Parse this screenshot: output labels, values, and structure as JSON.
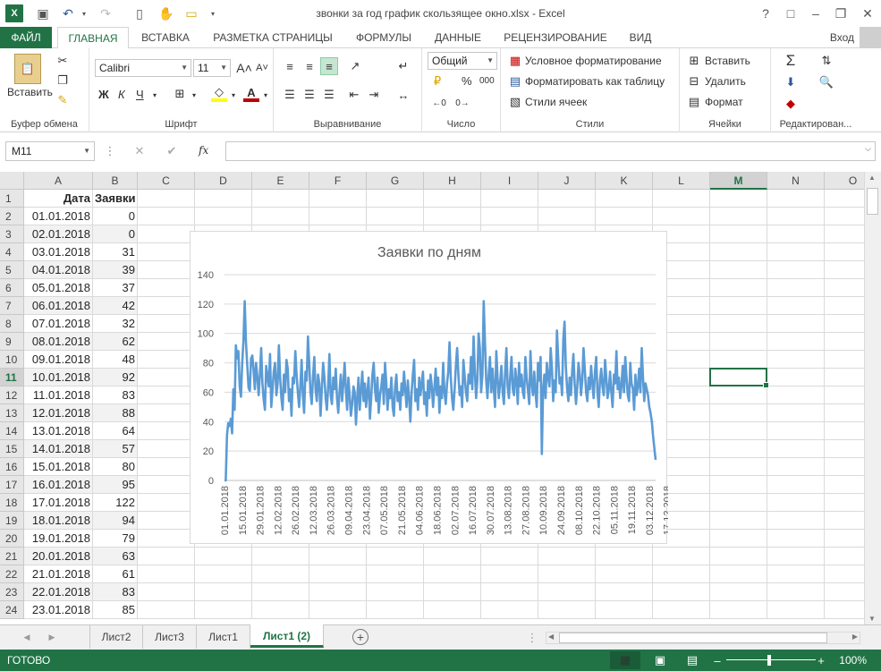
{
  "window": {
    "title": "звонки за год график скользящее окно.xlsx - Excel",
    "help": "?",
    "login": "Вход"
  },
  "tabs": [
    {
      "label": "ФАЙЛ"
    },
    {
      "label": "ГЛАВНАЯ"
    },
    {
      "label": "ВСТАВКА"
    },
    {
      "label": "РАЗМЕТКА СТРАНИЦЫ"
    },
    {
      "label": "ФОРМУЛЫ"
    },
    {
      "label": "ДАННЫЕ"
    },
    {
      "label": "РЕЦЕНЗИРОВАНИЕ"
    },
    {
      "label": "ВИД"
    }
  ],
  "ribbon": {
    "clipboard": {
      "paste": "Вставить",
      "label": "Буфер обмена"
    },
    "font": {
      "name": "Calibri",
      "size": "11",
      "bold": "Ж",
      "italic": "К",
      "underline": "Ч",
      "label": "Шрифт"
    },
    "alignment": {
      "label": "Выравнивание"
    },
    "number": {
      "format": "Общий",
      "percent": "%",
      "thousands": "000",
      "label": "Число"
    },
    "styles": {
      "conditional": "Условное форматирование",
      "as_table": "Форматировать как таблицу",
      "cell_styles": "Стили ячеек",
      "label": "Стили"
    },
    "cells": {
      "insert": "Вставить",
      "delete": "Удалить",
      "format": "Формат",
      "label": "Ячейки"
    },
    "editing": {
      "label": "Редактирован..."
    }
  },
  "formula_bar": {
    "name_box": "M11",
    "fx": "fx",
    "value": ""
  },
  "columns": [
    "A",
    "B",
    "C",
    "D",
    "E",
    "F",
    "G",
    "H",
    "I",
    "J",
    "K",
    "L",
    "M",
    "N",
    "O"
  ],
  "selected_column": "M",
  "selected_row": "11",
  "header_row": {
    "a": "Дата",
    "b": "Заявки"
  },
  "rows": [
    {
      "n": "1"
    },
    {
      "n": "2",
      "a": "01.01.2018",
      "b": "0"
    },
    {
      "n": "3",
      "a": "02.01.2018",
      "b": "0"
    },
    {
      "n": "4",
      "a": "03.01.2018",
      "b": "31"
    },
    {
      "n": "5",
      "a": "04.01.2018",
      "b": "39"
    },
    {
      "n": "6",
      "a": "05.01.2018",
      "b": "37"
    },
    {
      "n": "7",
      "a": "06.01.2018",
      "b": "42"
    },
    {
      "n": "8",
      "a": "07.01.2018",
      "b": "32"
    },
    {
      "n": "9",
      "a": "08.01.2018",
      "b": "62"
    },
    {
      "n": "10",
      "a": "09.01.2018",
      "b": "48"
    },
    {
      "n": "11",
      "a": "10.01.2018",
      "b": "92"
    },
    {
      "n": "12",
      "a": "11.01.2018",
      "b": "83"
    },
    {
      "n": "13",
      "a": "12.01.2018",
      "b": "88"
    },
    {
      "n": "14",
      "a": "13.01.2018",
      "b": "64"
    },
    {
      "n": "15",
      "a": "14.01.2018",
      "b": "57"
    },
    {
      "n": "16",
      "a": "15.01.2018",
      "b": "80"
    },
    {
      "n": "17",
      "a": "16.01.2018",
      "b": "95"
    },
    {
      "n": "18",
      "a": "17.01.2018",
      "b": "122"
    },
    {
      "n": "19",
      "a": "18.01.2018",
      "b": "94"
    },
    {
      "n": "20",
      "a": "19.01.2018",
      "b": "79"
    },
    {
      "n": "21",
      "a": "20.01.2018",
      "b": "63"
    },
    {
      "n": "22",
      "a": "21.01.2018",
      "b": "61"
    },
    {
      "n": "23",
      "a": "22.01.2018",
      "b": "83"
    },
    {
      "n": "24",
      "a": "23.01.2018",
      "b": "85"
    }
  ],
  "sheets": [
    "Лист2",
    "Лист3",
    "Лист1",
    "Лист1 (2)"
  ],
  "active_sheet": "Лист1 (2)",
  "status": {
    "ready": "ГОТОВО",
    "zoom": "100%"
  },
  "colors": {
    "accent": "#217346",
    "series": "#5b9bd5"
  },
  "chart_data": {
    "type": "line",
    "title": "Заявки по дням",
    "xlabel": "",
    "ylabel": "",
    "ylim": [
      0,
      140
    ],
    "yticks": [
      0,
      20,
      40,
      60,
      80,
      100,
      120,
      140
    ],
    "x_start": "01.01.2018",
    "x_end": "31.12.2018",
    "xtick_labels": [
      "01.01.2018",
      "15.01.2018",
      "29.01.2018",
      "12.02.2018",
      "26.02.2018",
      "12.03.2018",
      "26.03.2018",
      "09.04.2018",
      "23.04.2018",
      "07.05.2018",
      "21.05.2018",
      "04.06.2018",
      "18.06.2018",
      "02.07.2018",
      "16.07.2018",
      "30.07.2018",
      "13.08.2018",
      "27.08.2018",
      "10.09.2018",
      "24.09.2018",
      "08.10.2018",
      "22.10.2018",
      "05.11.2018",
      "19.11.2018",
      "03.12.2018",
      "17.12.2018"
    ],
    "grid": true,
    "series": [
      {
        "values": [
          0,
          0,
          31,
          39,
          37,
          42,
          32,
          62,
          48,
          92,
          83,
          88,
          64,
          57,
          80,
          95,
          122,
          94,
          79,
          63,
          61,
          83,
          85,
          75,
          62,
          80,
          70,
          58,
          72,
          90,
          66,
          55,
          48,
          78,
          70,
          64,
          86,
          50,
          62,
          74,
          80,
          58,
          66,
          92,
          70,
          56,
          48,
          72,
          60,
          82,
          76,
          54,
          62,
          44,
          70,
          66,
          88,
          72,
          60,
          50,
          64,
          82,
          58,
          46,
          74,
          68,
          98,
          80,
          60,
          52,
          70,
          84,
          62,
          54,
          72,
          66,
          44,
          62,
          80,
          70,
          56,
          48,
          64,
          86,
          58,
          52,
          70,
          62,
          76,
          56,
          46,
          60,
          72,
          54,
          66,
          80,
          62,
          48,
          70,
          58,
          44,
          52,
          64,
          60,
          38,
          56,
          70,
          48,
          62,
          74,
          54,
          66,
          50,
          60,
          70,
          42,
          56,
          72,
          80,
          62,
          54,
          70,
          46,
          58,
          64,
          72,
          52,
          80,
          66,
          48,
          62,
          56,
          70,
          50,
          44,
          64,
          72,
          54,
          60,
          48,
          66,
          58,
          74,
          62,
          50,
          68,
          56,
          40,
          60,
          72,
          82,
          54,
          62,
          48,
          70,
          58,
          66,
          74,
          52,
          60,
          44,
          68,
          56,
          72,
          64,
          50,
          62,
          76,
          58,
          70,
          46,
          64,
          56,
          80,
          60,
          52,
          66,
          74,
          94,
          70,
          56,
          48,
          62,
          78,
          90,
          72,
          58,
          64,
          50,
          82,
          70,
          60,
          54,
          72,
          66,
          84,
          62,
          98,
          74,
          56,
          68,
          100,
          90,
          60,
          72,
          122,
          94,
          68,
          56,
          72,
          84,
          60,
          76,
          62,
          50,
          88,
          70,
          56,
          66,
          78,
          60,
          52,
          74,
          90,
          64,
          56,
          70,
          84,
          62,
          58,
          76,
          68,
          52,
          80,
          64,
          72,
          60,
          56,
          84,
          70,
          62,
          52,
          88,
          66,
          58,
          74,
          60,
          50,
          80,
          68,
          84,
          18,
          62,
          72,
          56,
          80,
          70,
          64,
          90,
          76,
          54,
          68,
          60,
          102,
          82,
          66,
          70,
          58,
          96,
          108,
          78,
          62,
          54,
          70,
          58,
          74,
          86,
          66,
          52,
          64,
          80,
          72,
          58,
          68,
          90,
          76,
          60,
          54,
          70,
          62,
          78,
          66,
          56,
          74,
          84,
          60,
          50,
          68,
          76,
          64,
          58,
          82,
          70,
          56,
          62,
          74,
          60,
          50,
          72,
          66,
          88,
          62,
          70,
          56,
          64,
          78,
          60,
          84,
          70,
          58,
          54,
          80,
          66,
          62,
          48,
          72,
          58,
          64,
          76,
          60,
          90,
          70,
          54,
          66,
          62,
          58,
          50,
          46,
          40,
          30,
          22,
          14
        ]
      }
    ]
  }
}
